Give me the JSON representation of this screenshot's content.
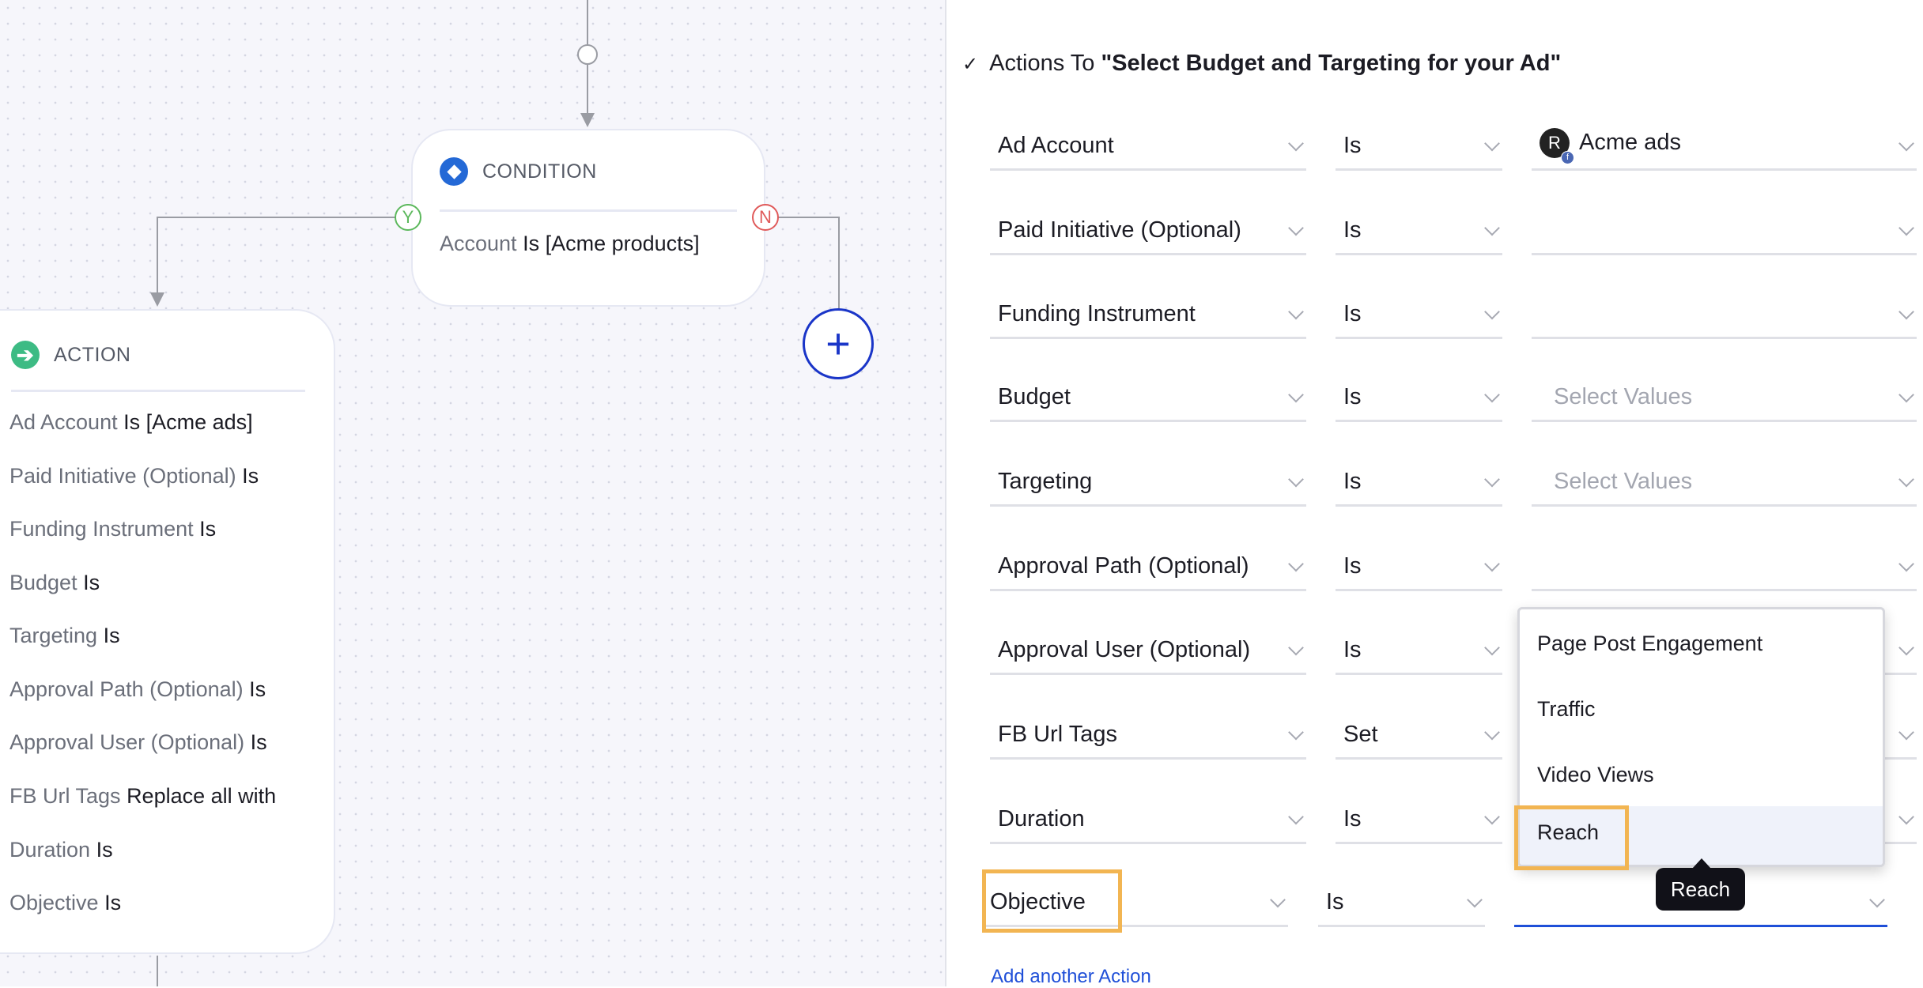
{
  "condition": {
    "header": "CONDITION",
    "field": "Account",
    "operator": "Is",
    "value": "[Acme products]",
    "yes_label": "Y",
    "no_label": "N",
    "add_label": "+"
  },
  "action": {
    "header": "ACTION",
    "rows": [
      {
        "field": "Ad Account",
        "op": "Is [Acme ads]"
      },
      {
        "field": "Paid Initiative (Optional)",
        "op": "Is"
      },
      {
        "field": "Funding Instrument",
        "op": "Is"
      },
      {
        "field": "Budget",
        "op": "Is"
      },
      {
        "field": "Targeting",
        "op": "Is"
      },
      {
        "field": "Approval Path (Optional)",
        "op": "Is"
      },
      {
        "field": "Approval User (Optional)",
        "op": "Is"
      },
      {
        "field": "FB Url Tags",
        "op": "Replace all with"
      },
      {
        "field": "Duration",
        "op": "Is"
      },
      {
        "field": "Objective",
        "op": "Is"
      }
    ]
  },
  "panel": {
    "check": "✓",
    "title_prefix": "Actions To ",
    "title_name": "\"Select Budget and Targeting for your Ad\"",
    "rows": [
      {
        "field": "Ad Account",
        "op": "Is",
        "value": "Acme ads",
        "placeholder": ""
      },
      {
        "field": "Paid Initiative (Optional)",
        "op": "Is",
        "value": "",
        "placeholder": ""
      },
      {
        "field": "Funding Instrument",
        "op": "Is",
        "value": "",
        "placeholder": ""
      },
      {
        "field": "Budget",
        "op": "Is",
        "value": "",
        "placeholder": "Select Values"
      },
      {
        "field": "Targeting",
        "op": "Is",
        "value": "",
        "placeholder": "Select Values"
      },
      {
        "field": "Approval Path (Optional)",
        "op": "Is",
        "value": "",
        "placeholder": ""
      },
      {
        "field": "Approval User (Optional)",
        "op": "Is",
        "value": "",
        "placeholder": ""
      },
      {
        "field": "FB Url Tags",
        "op": "Set",
        "value": "",
        "placeholder": ""
      },
      {
        "field": "Duration",
        "op": "Is",
        "value": "",
        "placeholder": ""
      },
      {
        "field": "Objective",
        "op": "Is",
        "value": "",
        "placeholder": ""
      }
    ],
    "dropdown_options": [
      "Page Post Engagement",
      "Traffic",
      "Video Views",
      "Reach"
    ],
    "highlighted_option": "Reach",
    "tooltip": "Reach",
    "add_action": "Add another Action"
  },
  "colors": {
    "accent": "#1f4fd8",
    "highlight_box": "#f2b552",
    "yes": "#5cb85c",
    "no": "#e05a5a",
    "action_icon": "#3dbb84",
    "condition_icon": "#2469d6"
  }
}
